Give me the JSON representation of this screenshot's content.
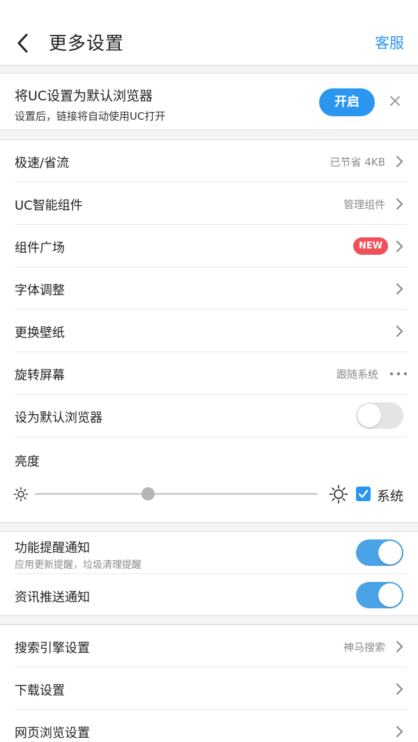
{
  "header": {
    "title": "更多设置",
    "service_label": "客服"
  },
  "banner": {
    "title": "将UC设置为默认浏览器",
    "subtitle": "设置后，链接将自动使用UC打开",
    "open_label": "开启"
  },
  "settings": {
    "speed": {
      "label": "极速/省流",
      "value": "已节省 4KB"
    },
    "widgets": {
      "label": "UC智能组件",
      "value": "管理组件"
    },
    "widget_square": {
      "label": "组件广场",
      "badge": "NEW"
    },
    "font": {
      "label": "字体调整"
    },
    "wallpaper": {
      "label": "更换壁纸"
    },
    "rotate": {
      "label": "旋转屏幕",
      "value": "跟随系统"
    },
    "default_browser": {
      "label": "设为默认浏览器",
      "enabled": false
    }
  },
  "brightness": {
    "label": "亮度",
    "level": 0.4,
    "system_label": "系统",
    "system_checked": true
  },
  "notifications": {
    "feature": {
      "label": "功能提醒通知",
      "subtitle": "应用更新提醒，垃圾清理提醒",
      "enabled": true
    },
    "news": {
      "label": "资讯推送通知",
      "enabled": true
    }
  },
  "more": {
    "search": {
      "label": "搜索引擎设置",
      "value": "神马搜索"
    },
    "download": {
      "label": "下载设置"
    },
    "browsing": {
      "label": "网页浏览设置"
    }
  },
  "colors": {
    "accent": "#2b96f0",
    "badge": "#f0505a",
    "toggle_on": "#4aa3e6",
    "toggle_off": "#e4e4e4"
  }
}
